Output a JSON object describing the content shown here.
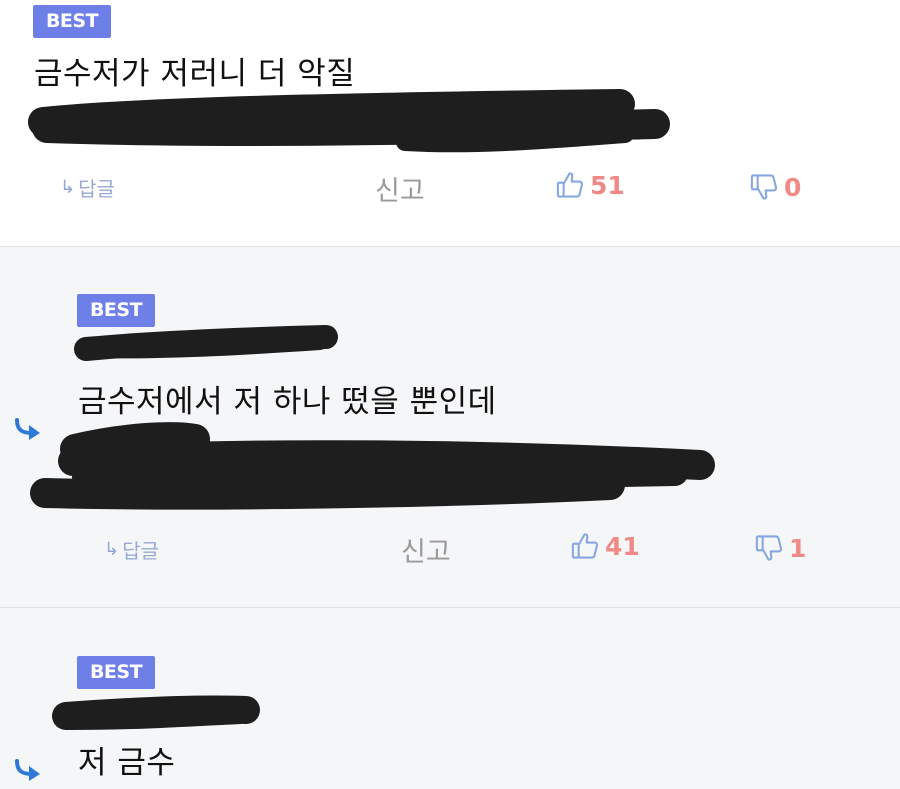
{
  "comments": [
    {
      "badge": "BEST",
      "text": "금수저가 저러니 더 악질",
      "reply_label": "답글",
      "report_label": "신고",
      "likes": "51",
      "dislikes": "0"
    },
    {
      "badge": "BEST",
      "text": "금수저에서 저 하나 떴을 뿐인데",
      "reply_label": "답글",
      "report_label": "신고",
      "likes": "41",
      "dislikes": "1"
    },
    {
      "badge": "BEST",
      "text": "저 금수"
    }
  ],
  "colors": {
    "badge": "#6f7fe8",
    "vote_count": "#ef8a87",
    "thumb_icon": "#86a7e0",
    "reply_marker": "#2c7ad6",
    "reply_section_bg": "#f5f6f8",
    "redaction": "#1e1e1e"
  },
  "icons": {
    "reply_arrow": "reply-arrow-icon",
    "like": "thumbs-up-icon",
    "dislike": "thumbs-down-icon",
    "nested_reply": "nested-reply-arrow-icon",
    "redaction": "redaction-scribble"
  }
}
